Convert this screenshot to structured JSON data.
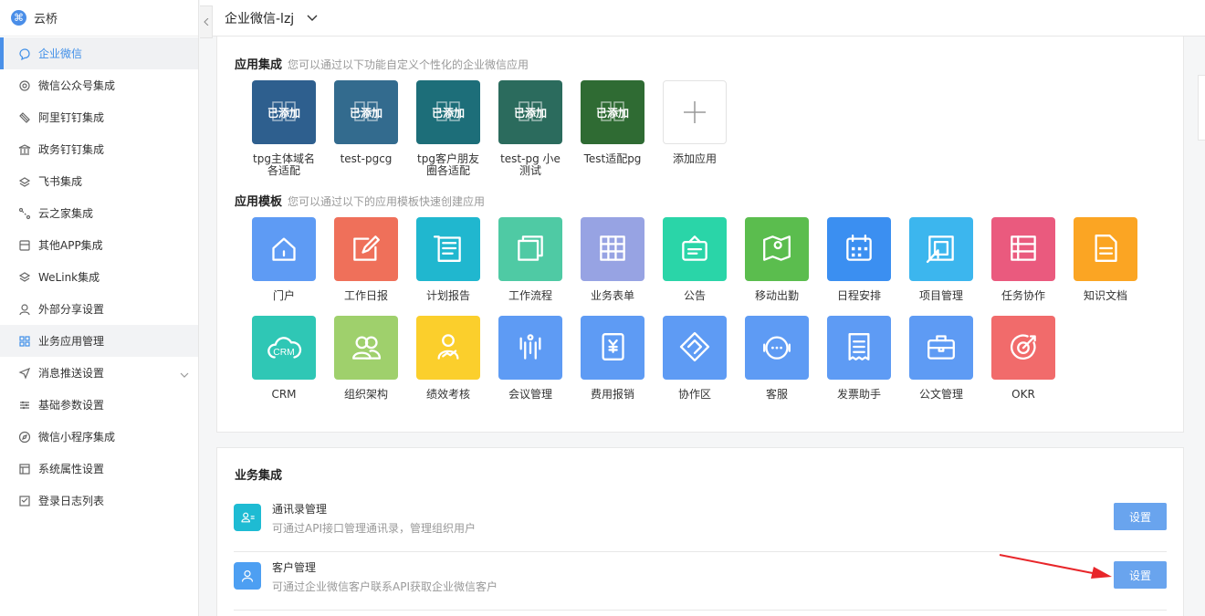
{
  "brand": {
    "name": "云桥"
  },
  "sidebar": {
    "items": [
      {
        "label": "企业微信",
        "icon": "chat-icon",
        "state": "active"
      },
      {
        "label": "微信公众号集成",
        "icon": "settings-icon"
      },
      {
        "label": "阿里钉钉集成",
        "icon": "pin-icon"
      },
      {
        "label": "政务钉钉集成",
        "icon": "bank-icon"
      },
      {
        "label": "飞书集成",
        "icon": "feishu-icon"
      },
      {
        "label": "云之家集成",
        "icon": "share-icon"
      },
      {
        "label": "其他APP集成",
        "icon": "app-icon"
      },
      {
        "label": "WeLink集成",
        "icon": "layers-icon"
      },
      {
        "label": "外部分享设置",
        "icon": "user-icon"
      },
      {
        "label": "业务应用管理",
        "icon": "grid-icon",
        "state": "highlight"
      },
      {
        "label": "消息推送设置",
        "icon": "send-icon",
        "has_chevron": true
      },
      {
        "label": "基础参数设置",
        "icon": "sliders-icon"
      },
      {
        "label": "微信小程序集成",
        "icon": "compass-icon"
      },
      {
        "label": "系统属性设置",
        "icon": "form-icon"
      },
      {
        "label": "登录日志列表",
        "icon": "log-icon"
      }
    ]
  },
  "topbar": {
    "corp_name": "企业微信-lzj"
  },
  "app_integration": {
    "title": "应用集成",
    "subtitle": "您可以通过以下功能自定义个性化的企业微信应用",
    "added_label": "已添加",
    "apps": [
      {
        "label": "tpg主体域名各适配",
        "color": "#2e5f8e"
      },
      {
        "label": "test-pgcg",
        "color": "#336b8e"
      },
      {
        "label": "tpg客户朋友圈各适配",
        "color": "#1d6e79"
      },
      {
        "label": "test-pg 小e测试",
        "color": "#2b6b5d"
      },
      {
        "label": "Test适配pg",
        "color": "#2f6b33"
      }
    ],
    "add_label": "添加应用"
  },
  "templates": {
    "title": "应用模板",
    "subtitle": "您可以通过以下的应用模板快速创建应用",
    "items": [
      {
        "label": "门户",
        "color": "#5e9bf4",
        "icon": "home-icon"
      },
      {
        "label": "工作日报",
        "color": "#ef705a",
        "icon": "edit-icon"
      },
      {
        "label": "计划报告",
        "color": "#20b7cf",
        "icon": "report-icon"
      },
      {
        "label": "工作流程",
        "color": "#4fcaa4",
        "icon": "stack-icon"
      },
      {
        "label": "业务表单",
        "color": "#97a3e3",
        "icon": "table-icon"
      },
      {
        "label": "公告",
        "color": "#2ad5a8",
        "icon": "notice-icon"
      },
      {
        "label": "移动出勤",
        "color": "#5bbd4e",
        "icon": "map-pin-icon"
      },
      {
        "label": "日程安排",
        "color": "#3b8ff1",
        "icon": "calendar-icon"
      },
      {
        "label": "项目管理",
        "color": "#3cb6ee",
        "icon": "project-icon"
      },
      {
        "label": "任务协作",
        "color": "#ea5a7e",
        "icon": "task-icon"
      },
      {
        "label": "知识文档",
        "color": "#fba523",
        "icon": "document-icon"
      },
      {
        "label": "CRM",
        "color": "#2fc7b5",
        "icon": "crm-cloud-icon"
      },
      {
        "label": "组织架构",
        "color": "#9fd06c",
        "icon": "people-icon"
      },
      {
        "label": "绩效考核",
        "color": "#fbcf2c",
        "icon": "performance-icon"
      },
      {
        "label": "会议管理",
        "color": "#5e9bf4",
        "icon": "meeting-icon"
      },
      {
        "label": "费用报销",
        "color": "#5e9bf4",
        "icon": "expense-icon"
      },
      {
        "label": "协作区",
        "color": "#5e9bf4",
        "icon": "collab-icon"
      },
      {
        "label": "客服",
        "color": "#5e9bf4",
        "icon": "support-icon"
      },
      {
        "label": "发票助手",
        "color": "#5e9bf4",
        "icon": "invoice-icon"
      },
      {
        "label": "公文管理",
        "color": "#5e9bf4",
        "icon": "briefcase-icon"
      },
      {
        "label": "OKR",
        "color": "#f16b6b",
        "icon": "target-icon"
      }
    ]
  },
  "business": {
    "title": "业务集成",
    "rows": [
      {
        "title": "通讯录管理",
        "desc": "可通过API接口管理通讯录，管理组织用户",
        "button": "设置",
        "icon_color": "#1ebbd3",
        "icon": "contacts-icon"
      },
      {
        "title": "客户管理",
        "desc": "可通过企业微信客户联系API获取企业微信客户",
        "button": "设置",
        "icon_color": "#4d9ff2",
        "icon": "customer-icon"
      }
    ]
  }
}
